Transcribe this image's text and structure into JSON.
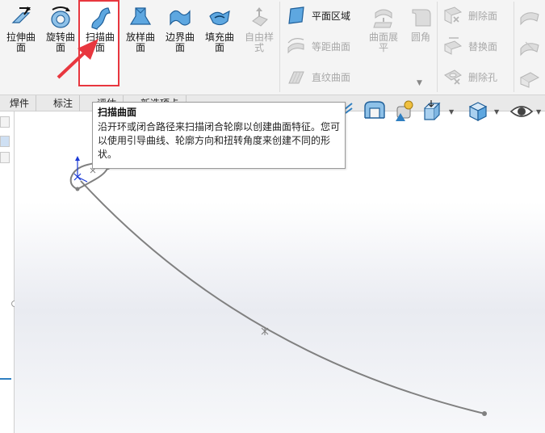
{
  "ribbon": {
    "large_buttons": [
      {
        "id": "extrude-surface",
        "label": "拉伸曲面",
        "icon": "extrude-surface-icon",
        "disabled": false
      },
      {
        "id": "revolve-surface",
        "label": "旋转曲面",
        "icon": "revolve-surface-icon",
        "disabled": false
      },
      {
        "id": "sweep-surface",
        "label": "扫描曲面",
        "icon": "sweep-surface-icon",
        "disabled": false
      },
      {
        "id": "loft-surface",
        "label": "放样曲面",
        "icon": "loft-surface-icon",
        "disabled": false
      },
      {
        "id": "boundary-surface",
        "label": "边界曲面",
        "icon": "boundary-surface-icon",
        "disabled": false
      },
      {
        "id": "fill-surface",
        "label": "填充曲面",
        "icon": "fill-surface-icon",
        "disabled": false
      },
      {
        "id": "freeform",
        "label": "自由样式",
        "icon": "freeform-icon",
        "disabled": true
      }
    ],
    "small_group_1": [
      {
        "id": "planar-surface",
        "label": "平面区域",
        "icon": "planar-surface-icon",
        "disabled": false
      },
      {
        "id": "offset-surface",
        "label": "等距曲面",
        "icon": "offset-surface-icon",
        "disabled": true
      },
      {
        "id": "ruled-surface",
        "label": "直纹曲面",
        "icon": "ruled-surface-icon",
        "disabled": true
      }
    ],
    "medium_buttons": [
      {
        "id": "surface-flatten",
        "label": "曲面展平",
        "icon": "surface-flatten-icon",
        "disabled": true
      },
      {
        "id": "fillet",
        "label": "圆角",
        "icon": "fillet-icon",
        "disabled": true
      }
    ],
    "small_group_2": [
      {
        "id": "delete-face",
        "label": "删除面",
        "icon": "delete-face-icon",
        "disabled": true
      },
      {
        "id": "replace-face",
        "label": "替换面",
        "icon": "replace-face-icon",
        "disabled": true
      },
      {
        "id": "delete-hole",
        "label": "删除孔",
        "icon": "delete-hole-icon",
        "disabled": true
      }
    ]
  },
  "tabs": [
    {
      "label": "焊件"
    },
    {
      "label": "标注"
    },
    {
      "label": "评估"
    },
    {
      "label": "新选项卡"
    }
  ],
  "tooltip": {
    "title": "扫描曲面",
    "body": "沿开环或闭合路径来扫描闭合轮廓以创建曲面特征。您可以使用引导曲线、轮廓方向和扭转角度来创建不同的形状。"
  },
  "colors": {
    "accent": "#2f7fc1",
    "highlight": "#e8373f",
    "sketch_line": "#808080"
  }
}
